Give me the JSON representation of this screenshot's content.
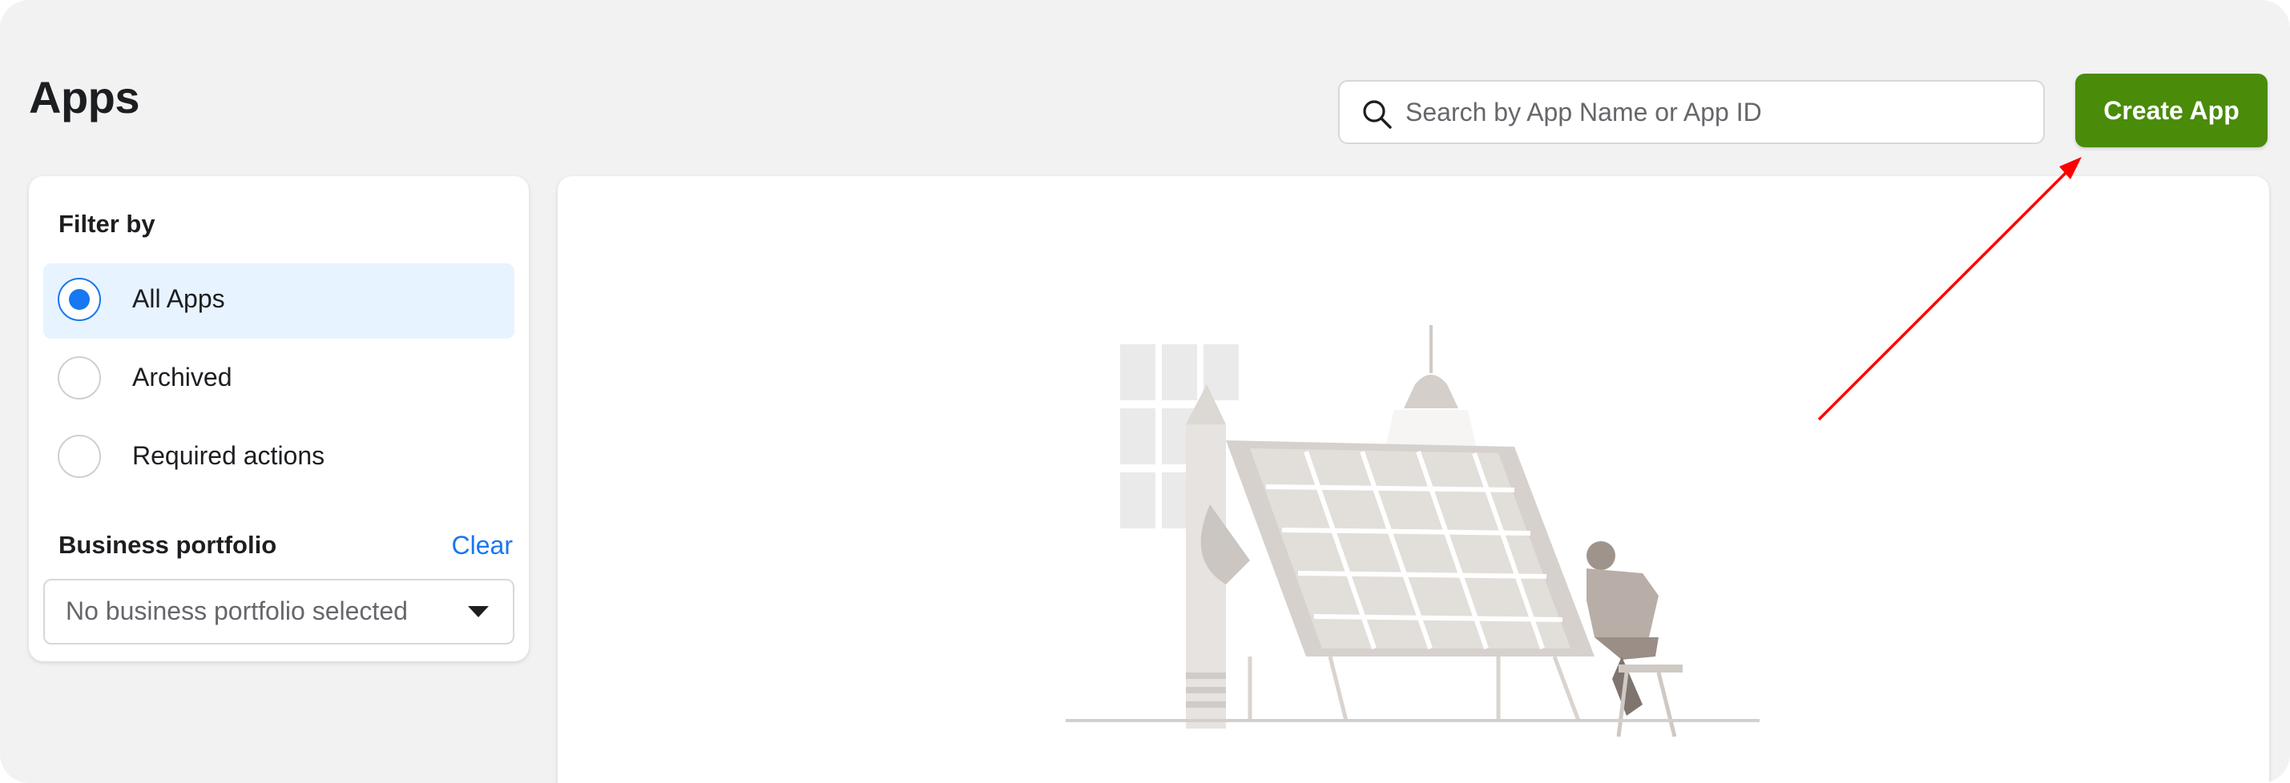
{
  "header": {
    "title": "Apps",
    "search_placeholder": "Search by App Name or App ID",
    "search_value": "",
    "create_label": "Create App"
  },
  "filters": {
    "title": "Filter by",
    "options": [
      {
        "label": "All Apps",
        "selected": true
      },
      {
        "label": "Archived",
        "selected": false
      },
      {
        "label": "Required actions",
        "selected": false
      }
    ],
    "business_label": "Business portfolio",
    "clear_label": "Clear",
    "business_select_value": "No business portfolio selected"
  },
  "colors": {
    "primary_button": "#4a8b0a",
    "link": "#1877f2",
    "selected_row": "#e7f3ff",
    "annotation_arrow": "#ff0000"
  },
  "icons": {
    "search": "search-icon",
    "caret": "caret-down-icon",
    "empty_state": "empty-state-illustration"
  }
}
